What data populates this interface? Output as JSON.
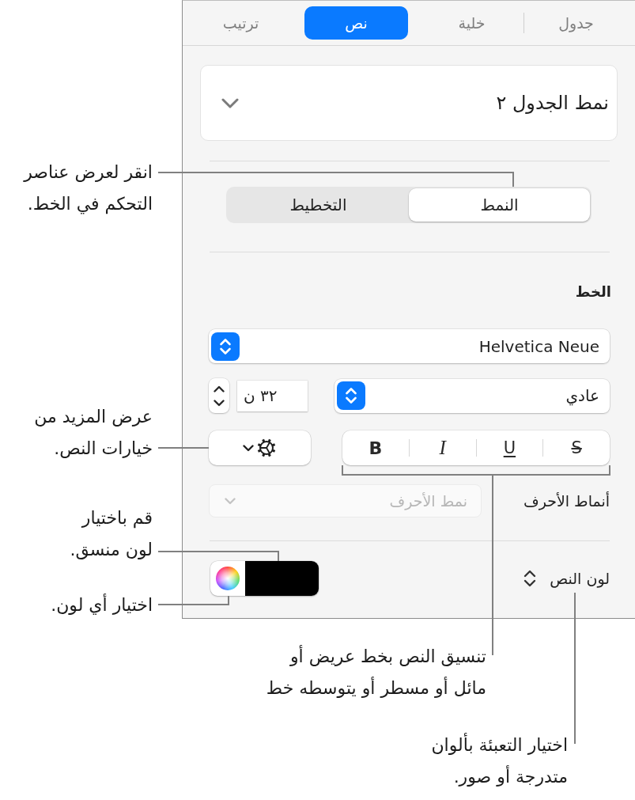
{
  "tabs": [
    {
      "label": "جدول",
      "selected": false
    },
    {
      "label": "خلية",
      "selected": false
    },
    {
      "label": "نص",
      "selected": true
    },
    {
      "label": "ترتيب",
      "selected": false
    }
  ],
  "table_style": {
    "value": "نمط الجدول ٢"
  },
  "segments": [
    {
      "label": "النمط",
      "selected": true
    },
    {
      "label": "التخطيط",
      "selected": false
    }
  ],
  "font": {
    "heading": "الخط",
    "family": "Helvetica Neue",
    "typeface": "عادي",
    "size": "٣٢ ن",
    "style_buttons": [
      {
        "kind": "strikethrough",
        "label": "S",
        "on": false
      },
      {
        "kind": "underline",
        "label": "U",
        "on": false
      },
      {
        "kind": "italic",
        "label": "I",
        "on": false
      },
      {
        "kind": "bold",
        "label": "B",
        "on": false
      }
    ],
    "character_styles": {
      "label": "أنماط الأحرف",
      "placeholder": "نمط الأحرف",
      "disabled": true
    },
    "text_color": {
      "label": "لون النص",
      "color": "#000000"
    }
  },
  "callouts": [
    {
      "text": "انقر لعرض عناصر\nالتحكم في الخط."
    },
    {
      "text": "عرض المزيد من\nخيارات النص."
    },
    {
      "text": "قم باختيار\nلون منسق."
    },
    {
      "text": "اختيار أي لون."
    },
    {
      "text": "تنسيق النص بخط عريض أو\nمائل أو مسطر أو يتوسطه خط"
    },
    {
      "text": "اختيار التعبئة بألوان\nمتدرجة أو صور."
    }
  ]
}
